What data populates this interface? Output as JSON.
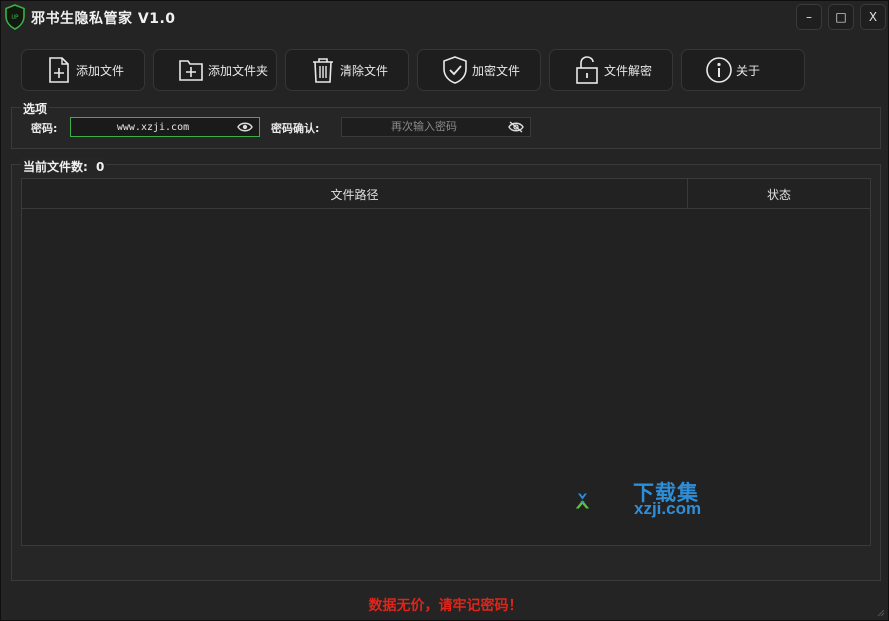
{
  "window": {
    "title": "邪书生隐私管家 V1.0",
    "controls": {
      "minimize": "–",
      "maximize": "□",
      "close": "X"
    }
  },
  "toolbar": {
    "items": [
      {
        "label": "添加文件",
        "icon": "file-add-icon"
      },
      {
        "label": "添加文件夹",
        "icon": "folder-add-icon"
      },
      {
        "label": "清除文件",
        "icon": "trash-icon"
      },
      {
        "label": "加密文件",
        "icon": "shield-check-icon"
      },
      {
        "label": "文件解密",
        "icon": "unlock-icon"
      },
      {
        "label": "关于",
        "icon": "info-icon"
      }
    ]
  },
  "options": {
    "title": "选项",
    "password_label": "密码:",
    "password_value": "www.xzji.com",
    "confirm_label": "密码确认:",
    "confirm_placeholder": "再次输入密码"
  },
  "files": {
    "count_label": "当前文件数:",
    "count": "0",
    "columns": [
      "文件路径",
      "状态"
    ],
    "rows": []
  },
  "watermark": {
    "text": "下载集",
    "url": "xzji.com"
  },
  "footer": {
    "warning": "数据无价，请牢记密码！"
  },
  "colors": {
    "accent_green": "#3fae49",
    "warning_red": "#e0241b",
    "watermark_blue": "#2e8fd8"
  }
}
